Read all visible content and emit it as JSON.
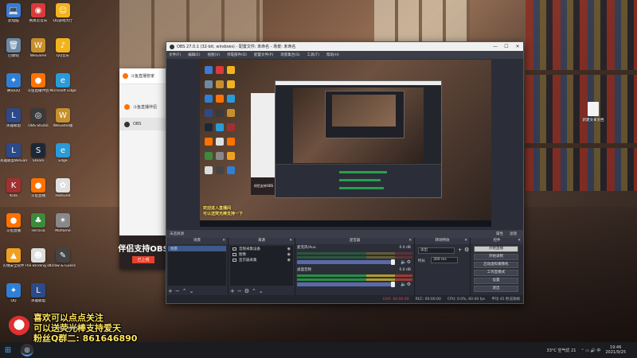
{
  "desktop": {
    "icons": [
      {
        "label": "此电脑",
        "glyph": "💻",
        "color": "#3b7ad6"
      },
      {
        "label": "网易云音乐",
        "glyph": "◉",
        "color": "#d93a3a"
      },
      {
        "label": "QQ游戏大厅",
        "glyph": "☺",
        "color": "#f2b31c"
      },
      {
        "label": "回收站",
        "glyph": "🗑",
        "color": "#6c8aa6"
      },
      {
        "label": "WeGame",
        "glyph": "W",
        "color": "#c8902c"
      },
      {
        "label": "QQ音乐",
        "glyph": "♪",
        "color": "#f2b31c"
      },
      {
        "label": "腾讯QQ",
        "glyph": "✦",
        "color": "#2f7fd6"
      },
      {
        "label": "斗鱼直播伴侣",
        "glyph": "●",
        "color": "#ff7200"
      },
      {
        "label": "Microsoft Edge",
        "glyph": "e",
        "color": "#2a9bd8"
      },
      {
        "label": "英雄联盟",
        "glyph": "L",
        "color": "#2c4a8a"
      },
      {
        "label": "OBS Studio",
        "glyph": "◎",
        "color": "#3a3a3a"
      },
      {
        "label": "WeGame版",
        "glyph": "W",
        "color": "#c8902c"
      },
      {
        "label": "英雄联盟WeGame版",
        "glyph": "L",
        "color": "#2c4a8a"
      },
      {
        "label": "Steam",
        "glyph": "S",
        "color": "#1b2838"
      },
      {
        "label": "Edge",
        "glyph": "e",
        "color": "#2a9bd8"
      },
      {
        "label": "Killa",
        "glyph": "K",
        "color": "#a23030"
      },
      {
        "label": "斗鱼直播",
        "glyph": "●",
        "color": "#ff7200"
      },
      {
        "label": "Hatsune",
        "glyph": "✿",
        "color": "#e0e0e0"
      },
      {
        "label": "斗鱼直播",
        "glyph": "●",
        "color": "#ff7200"
      },
      {
        "label": "Terraria",
        "glyph": "♣",
        "color": "#3c8a3c"
      },
      {
        "label": "Moflame",
        "glyph": "✶",
        "color": "#888"
      },
      {
        "label": "火绒安全软件",
        "glyph": "▲",
        "color": "#f0a020"
      },
      {
        "label": "The Binding of Isaac: Rebirth",
        "glyph": "☻",
        "color": "#ddd"
      },
      {
        "label": "Draw & Guess",
        "glyph": "✎",
        "color": "#444"
      },
      {
        "label": "QQ",
        "glyph": "✦",
        "color": "#2f7fd6"
      },
      {
        "label": "英雄联盟",
        "glyph": "L",
        "color": "#2c4a8a"
      }
    ],
    "right_icon_label": "新建文本文档"
  },
  "douyu_window": {
    "title": "斗鱼直播管家",
    "items": [
      "斗鱼直播伴侣",
      "OBS"
    ],
    "promo_big": "伴侣支持OBS",
    "promo_sub": "已上线"
  },
  "obs": {
    "title": "OBS 27.0.1 (32-bit, windows) - 配置文件: 未命名 - 场景: 未命名",
    "menu": [
      "文件(F)",
      "编辑(E)",
      "视图(V)",
      "停靠部件(D)",
      "配置文件(P)",
      "场景集合(S)",
      "工具(T)",
      "帮助(H)"
    ],
    "preview_overlay": [
      "欢迎进入直播间",
      "可以送荧光棒支持一下"
    ],
    "dockbar": {
      "scene_label": "未选择源",
      "props": "属性",
      "filters": "滤镜"
    },
    "docks": {
      "scenes": {
        "title": "场景",
        "items": [
          "场景"
        ]
      },
      "sources": {
        "title": "来源",
        "items": [
          "音频采集设备",
          "图像",
          "显示器采集"
        ]
      },
      "mixer": {
        "title": "混音器",
        "channels": [
          {
            "name": "麦克风/Aux",
            "db": "0.0 dB"
          },
          {
            "name": "桌面音频",
            "db": "0.0 dB"
          }
        ]
      },
      "transitions": {
        "title": "转场特效",
        "type": "淡出",
        "duration_label": "时长",
        "duration": "300 ms"
      },
      "controls": {
        "title": "控件",
        "buttons": [
          "开始直播",
          "开始录制",
          "启动虚拟摄像机",
          "工作室模式",
          "设置",
          "退出"
        ]
      }
    },
    "status": {
      "live": "LIVE: 00:00:00",
      "rec": "REC: 00:00:00",
      "cpu": "CPU: 0.0%, 60.00 fps",
      "fps": "平均 45 秒渲染帧"
    }
  },
  "chat": {
    "lines": [
      "喜欢可以点点关注",
      "可以送荧光棒支持爱天",
      "粉丝Q群二: 861646890"
    ],
    "small": "2021/09/25"
  },
  "taskbar": {
    "start_icon": "windows-icon",
    "tray": "33°C 空气优 21",
    "time": "19:46",
    "date": "2021/9/25"
  }
}
